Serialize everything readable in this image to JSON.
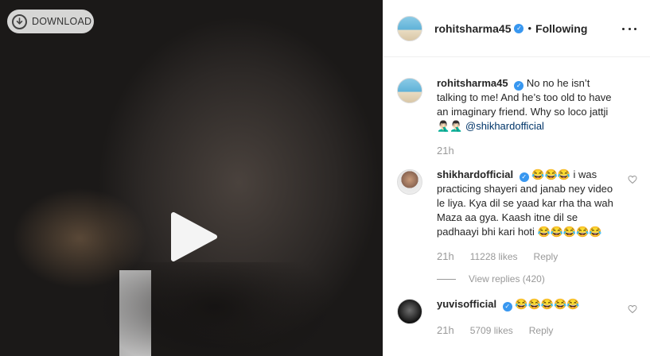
{
  "video": {
    "download_label": "DOWNLOAD",
    "download_icon": "download-icon",
    "play_icon": "play-icon"
  },
  "header": {
    "username": "rohitsharma45",
    "follow_status": "Following",
    "separator": "•",
    "more_icon": "more-options-icon"
  },
  "caption": {
    "username": "rohitsharma45",
    "text": "No no he isn’t talking to me! And he’s too old to have an imaginary friend. Why so loco jattji 🤦🏻‍♂️🤦🏻‍♂️",
    "mention": "@shikhardofficial",
    "time": "21h"
  },
  "comments": [
    {
      "username": "shikhardofficial",
      "text": "😂😂😂 i was practicing shayeri and janab ney video le liya. Kya dil se yaad kar rha tha wah Maza aa gya. Kaash itne dil se padhaayi bhi kari hoti 😂😂😂😂😂",
      "time": "21h",
      "likes": "11228 likes",
      "reply": "Reply",
      "view_replies": "View replies (420)"
    },
    {
      "username": "yuvisofficial",
      "text": "😂😂😂😂😂",
      "time": "21h",
      "likes": "5709 likes",
      "reply": "Reply"
    }
  ],
  "colors": {
    "verified": "#3897f0",
    "mention": "#003569",
    "meta": "#999999"
  }
}
